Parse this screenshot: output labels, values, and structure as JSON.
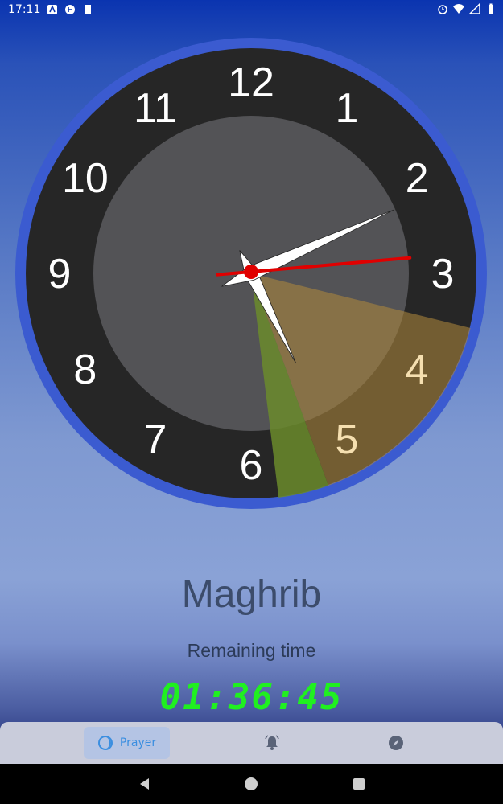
{
  "status_bar": {
    "time": "17:11",
    "left_icons": [
      "accessibility-icon",
      "sync-icon",
      "sd-card-icon"
    ],
    "right_icons": [
      "alarm-icon",
      "wifi-icon",
      "signal-icon",
      "battery-icon"
    ]
  },
  "clock": {
    "numbers": [
      "12",
      "1",
      "2",
      "3",
      "4",
      "5",
      "6",
      "7",
      "8",
      "9",
      "10",
      "11"
    ],
    "hour_hand_time": "5:11",
    "minute_hand_minutes": 11,
    "second_hand_seconds": 15,
    "colors": {
      "ring": "#3b5bd0",
      "dial": "#262626",
      "inner": "#535356",
      "sector_orange": "#b28a3c",
      "sector_green": "#6b8b2c",
      "second_hand": "#e00000",
      "hands": "#ffffff"
    }
  },
  "prayer": {
    "name": "Maghrib",
    "remaining_label": "Remaining time",
    "countdown": "01:36:45"
  },
  "bottom_nav": {
    "tabs": [
      {
        "label": "Prayer",
        "icon": "moon-icon",
        "active": true
      },
      {
        "label": "",
        "icon": "alarm-bell-icon",
        "active": false
      },
      {
        "label": "",
        "icon": "compass-icon",
        "active": false
      }
    ]
  },
  "system_nav": {
    "buttons": [
      "back-icon",
      "home-icon",
      "recents-icon"
    ]
  }
}
